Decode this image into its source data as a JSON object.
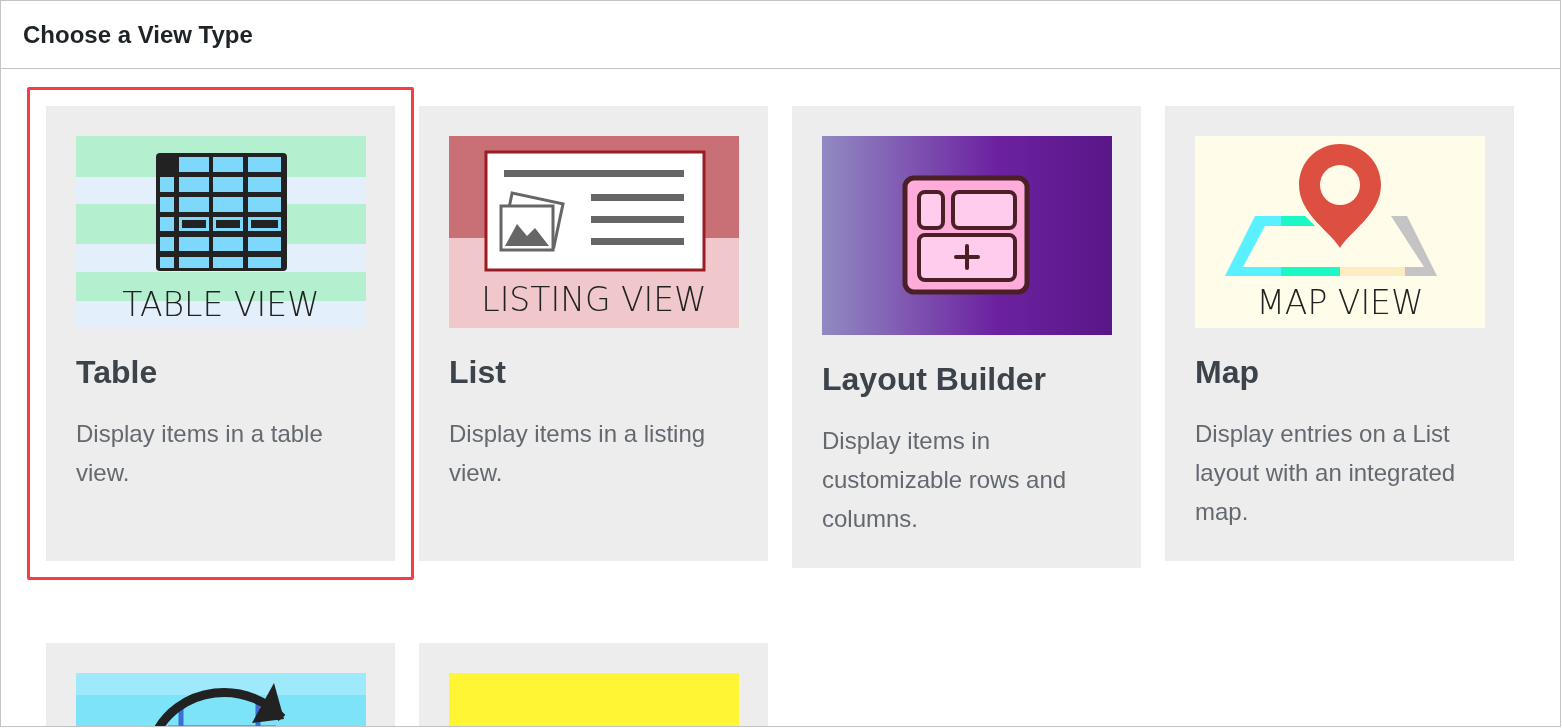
{
  "panel": {
    "title": "Choose a View Type"
  },
  "cards": [
    {
      "kind": "table",
      "selected": true,
      "thumbnail_text": "TABLE VIEW",
      "title": "Table",
      "description": "Display items in a table view."
    },
    {
      "kind": "listing",
      "selected": false,
      "thumbnail_text": "LISTING VIEW",
      "title": "List",
      "description": "Display items in a listing view."
    },
    {
      "kind": "layout",
      "selected": false,
      "title": "Layout Builder",
      "description": "Display items in customizable rows and columns."
    },
    {
      "kind": "map",
      "selected": false,
      "thumbnail_text": "MAP VIEW",
      "title": "Map",
      "description": "Display entries on a List layout with an integrated map."
    },
    {
      "kind": "globe",
      "selected": false
    },
    {
      "kind": "blank",
      "selected": false
    }
  ]
}
